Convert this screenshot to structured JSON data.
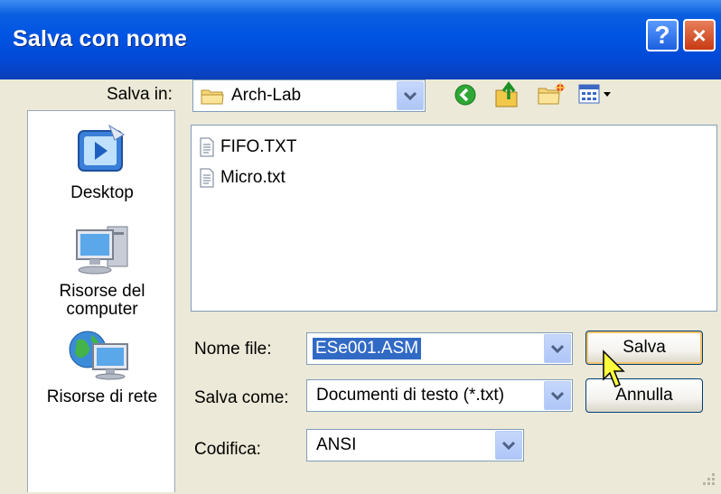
{
  "window": {
    "title": "Salva con nome",
    "help_label": "?",
    "close_label": "×"
  },
  "save_in": {
    "label": "Salva in:",
    "value": "Arch-Lab"
  },
  "places": [
    {
      "label": "Desktop"
    },
    {
      "label": "Risorse del computer"
    },
    {
      "label": "Risorse di rete"
    }
  ],
  "files": [
    {
      "name": "FIFO.TXT"
    },
    {
      "name": "Micro.txt"
    }
  ],
  "filename": {
    "label": "Nome file:",
    "value": "ESe001.ASM"
  },
  "save_as": {
    "label": "Salva come:",
    "value": "Documenti di testo (*.txt)"
  },
  "encoding": {
    "label": "Codifica:",
    "value": "ANSI"
  },
  "buttons": {
    "save": "Salva",
    "cancel": "Annulla"
  },
  "colors": {
    "title_bar": "#0054e3",
    "selection": "#316ac5",
    "dialog_bg": "#ece9d8"
  }
}
